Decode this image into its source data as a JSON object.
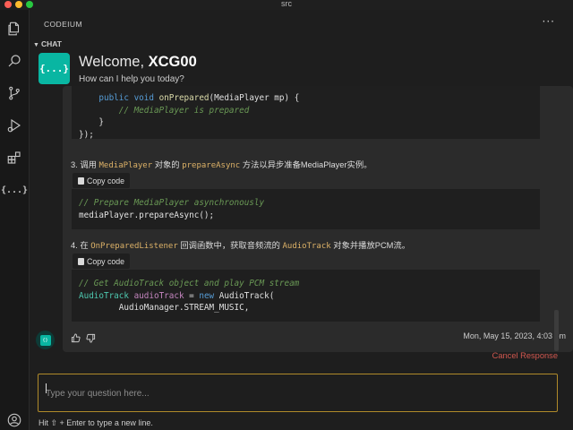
{
  "window": {
    "title": "src"
  },
  "panel": {
    "header": "CODEIUM",
    "more": "···",
    "section": "CHAT"
  },
  "activity": {
    "codeium_icon": "{...}"
  },
  "welcome": {
    "logo": "{...}",
    "greeting": "Welcome, ",
    "username": "XCG00",
    "subtitle": "How can I help you today?"
  },
  "message": {
    "code1": [
      {
        "indent": "    ",
        "parts": [
          {
            "t": "public void ",
            "c": "kw"
          },
          {
            "t": "onPrepared",
            "c": "fn"
          },
          {
            "t": "(MediaPlayer mp) {",
            "c": "plain"
          }
        ]
      },
      {
        "indent": "        ",
        "parts": [
          {
            "t": "// MediaPlayer is prepared",
            "c": "cm"
          }
        ]
      },
      {
        "indent": "    ",
        "parts": [
          {
            "t": "}",
            "c": "plain"
          }
        ]
      },
      {
        "indent": "",
        "parts": [
          {
            "t": "});",
            "c": "plain"
          }
        ]
      }
    ],
    "step3": {
      "prefix": "3. 调用 ",
      "code1": "MediaPlayer",
      "mid": " 对象的 ",
      "code2": "prepareAsync",
      "suffix": " 方法以异步准备MediaPlayer实例。"
    },
    "copy_label": "Copy code",
    "code2": [
      {
        "indent": "",
        "parts": [
          {
            "t": "// Prepare MediaPlayer asynchronously",
            "c": "cm"
          }
        ]
      },
      {
        "indent": "",
        "parts": [
          {
            "t": "mediaPlayer.prepareAsync();",
            "c": "plain"
          }
        ]
      }
    ],
    "step4": {
      "prefix": "4. 在 ",
      "code1": "OnPreparedListener",
      "mid": " 回调函数中，获取音频流的 ",
      "code2": "AudioTrack",
      "suffix": " 对象并播放PCM流。"
    },
    "code3": [
      {
        "indent": "",
        "parts": [
          {
            "t": "// Get AudioTrack object and play PCM stream",
            "c": "cm"
          }
        ]
      },
      {
        "indent": "",
        "parts": [
          {
            "t": "AudioTrack ",
            "c": "ty"
          },
          {
            "t": "audioTrack",
            "c": "vr"
          },
          {
            "t": " = ",
            "c": "plain"
          },
          {
            "t": "new ",
            "c": "kw"
          },
          {
            "t": "AudioTrack(",
            "c": "plain"
          }
        ]
      },
      {
        "indent": "        ",
        "parts": [
          {
            "t": "AudioManager.STREAM_MUSIC,",
            "c": "plain"
          }
        ]
      }
    ],
    "timestamp": "Mon, May 15, 2023, 4:03 pm"
  },
  "actions": {
    "cancel": "Cancel Response"
  },
  "input": {
    "placeholder": "Type your question here..."
  },
  "hint": "Hit ⇧ + Enter to type a new line.",
  "colors": {
    "accent": "#09b6a2",
    "input_border": "#b08a2a",
    "cancel": "#d0574f"
  }
}
